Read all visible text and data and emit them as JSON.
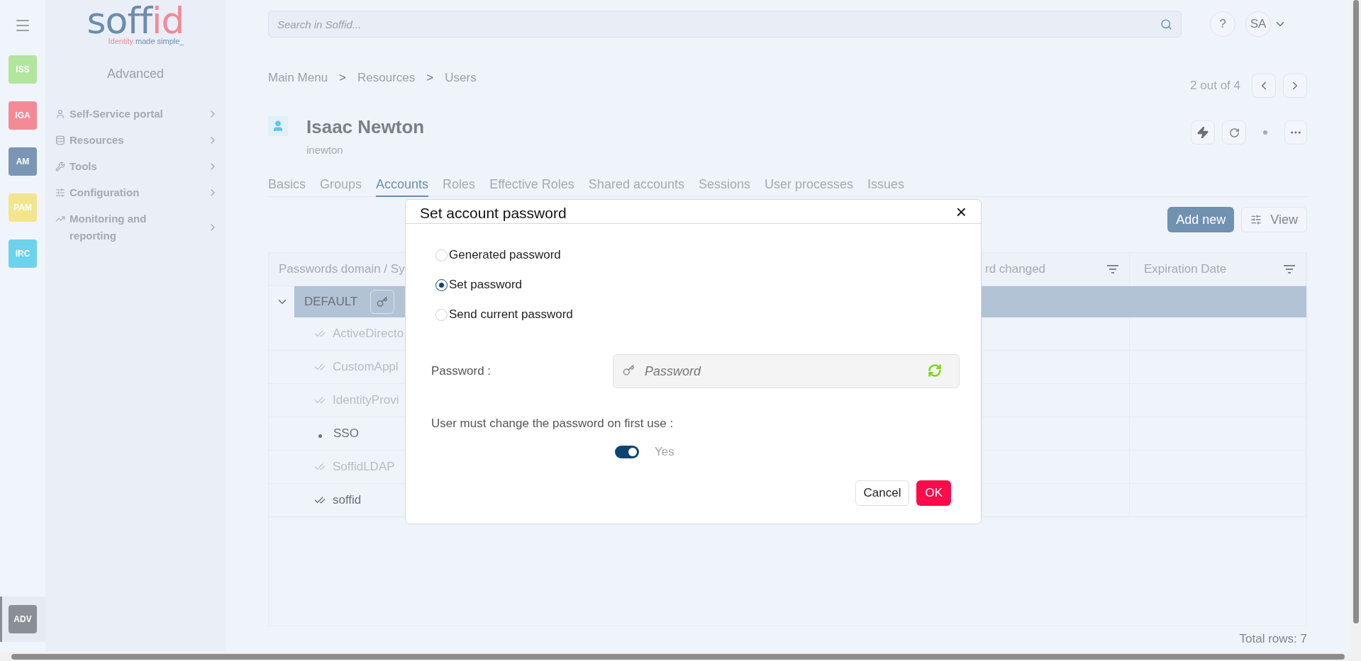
{
  "rail": {
    "apps": [
      {
        "label": "ISS",
        "color": "#b2e59e",
        "selected": false
      },
      {
        "label": "IGA",
        "color": "#f48a96",
        "selected": false
      },
      {
        "label": "AM",
        "color": "#7a96b4",
        "selected": false
      },
      {
        "label": "PAM",
        "color": "#f2e58e",
        "selected": false
      },
      {
        "label": "IRC",
        "color": "#6dd3ec",
        "selected": false
      },
      {
        "label": "ADV",
        "color": "#8a8e96",
        "selected": true
      }
    ]
  },
  "logo": {
    "main": "soff",
    "accent": "id",
    "tagline_accent": "Identity",
    "tagline": "made simple_"
  },
  "sidebar": {
    "title": "Advanced",
    "items": [
      {
        "label": "Self-Service portal"
      },
      {
        "label": "Resources"
      },
      {
        "label": "Tools"
      },
      {
        "label": "Configuration"
      },
      {
        "label": "Monitoring and reporting"
      }
    ]
  },
  "topbar": {
    "search": {
      "placeholder": "Search in Soffid..."
    },
    "help": "?",
    "account": "SA"
  },
  "breadcrumb": {
    "items": [
      "Main Menu",
      "Resources",
      "Users"
    ],
    "separator": ">"
  },
  "pager": {
    "text": "2 out of 4"
  },
  "user": {
    "name": "Isaac Newton",
    "login": "inewton"
  },
  "tabs": [
    {
      "label": "Basics",
      "selected": false
    },
    {
      "label": "Groups",
      "selected": false
    },
    {
      "label": "Accounts",
      "selected": true
    },
    {
      "label": "Roles",
      "selected": false
    },
    {
      "label": "Effective Roles",
      "selected": false
    },
    {
      "label": "Shared accounts",
      "selected": false
    },
    {
      "label": "Sessions",
      "selected": false
    },
    {
      "label": "User processes",
      "selected": false
    },
    {
      "label": "Issues",
      "selected": false
    }
  ],
  "toolbar": {
    "add": "Add new",
    "view": "View"
  },
  "table": {
    "columns": [
      "Passwords domain / Sy",
      "rd changed",
      "Expiration Date"
    ],
    "group": {
      "label": "DEFAULT",
      "expanded": true
    },
    "rows": [
      {
        "name": "ActiveDirecto",
        "kind": "check",
        "disabled": true
      },
      {
        "name": "CustomAppl",
        "kind": "check",
        "disabled": true
      },
      {
        "name": "IdentityProvi",
        "kind": "check",
        "disabled": true
      },
      {
        "name": "SSO",
        "kind": "dot",
        "disabled": false
      },
      {
        "name": "SoffidLDAP",
        "kind": "check",
        "disabled": true
      },
      {
        "name": "soffid",
        "kind": "check",
        "disabled": false
      }
    ],
    "total": "Total rows: 7"
  },
  "dialog": {
    "title": "Set account password",
    "close": "×",
    "options": [
      {
        "label": "Generated password",
        "selected": false
      },
      {
        "label": "Set password",
        "selected": true
      },
      {
        "label": "Send current password",
        "selected": false
      }
    ],
    "password": {
      "label": "Password :",
      "placeholder": "Password"
    },
    "must_change": {
      "label": "User must change the password on first use :",
      "on": true,
      "value": "Yes"
    },
    "cancel": "Cancel",
    "ok": "OK"
  }
}
